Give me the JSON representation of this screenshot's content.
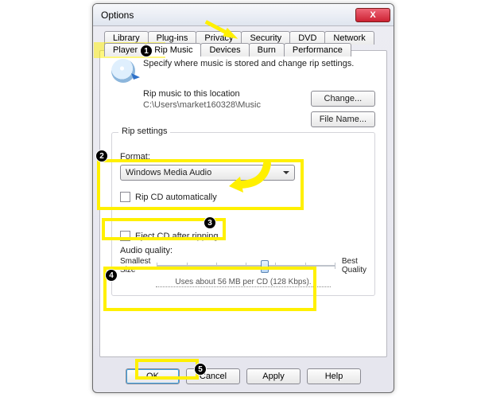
{
  "window": {
    "title": "Options",
    "close": "X"
  },
  "tabs": {
    "row1": [
      "Library",
      "Plug-ins",
      "Privacy",
      "Security",
      "DVD",
      "Network"
    ],
    "row2": [
      "Player",
      "Rip Music",
      "Devices",
      "Burn",
      "Performance"
    ],
    "active": "Rip Music"
  },
  "header": {
    "instruction": "Specify where music is stored and change rip settings."
  },
  "location": {
    "label": "Rip music to this location",
    "path": "C:\\Users\\market160328\\Music",
    "change_btn": "Change...",
    "filename_btn": "File Name..."
  },
  "rip": {
    "legend": "Rip settings",
    "format_label": "Format:",
    "format_value": "Windows Media Audio",
    "auto_label": "Rip CD automatically",
    "eject_label": "Eject CD after ripping",
    "aq_label": "Audio quality:",
    "aq_min": "Smallest\nSize",
    "aq_max": "Best\nQuality",
    "aq_info": "Uses about 56 MB per CD (128 Kbps).",
    "slider_pos_pct": 58
  },
  "buttons": {
    "ok": "OK",
    "cancel": "Cancel",
    "apply": "Apply",
    "help": "Help"
  },
  "steps": {
    "s1": "1",
    "s2": "2",
    "s3": "3",
    "s4": "4",
    "s5": "5"
  }
}
